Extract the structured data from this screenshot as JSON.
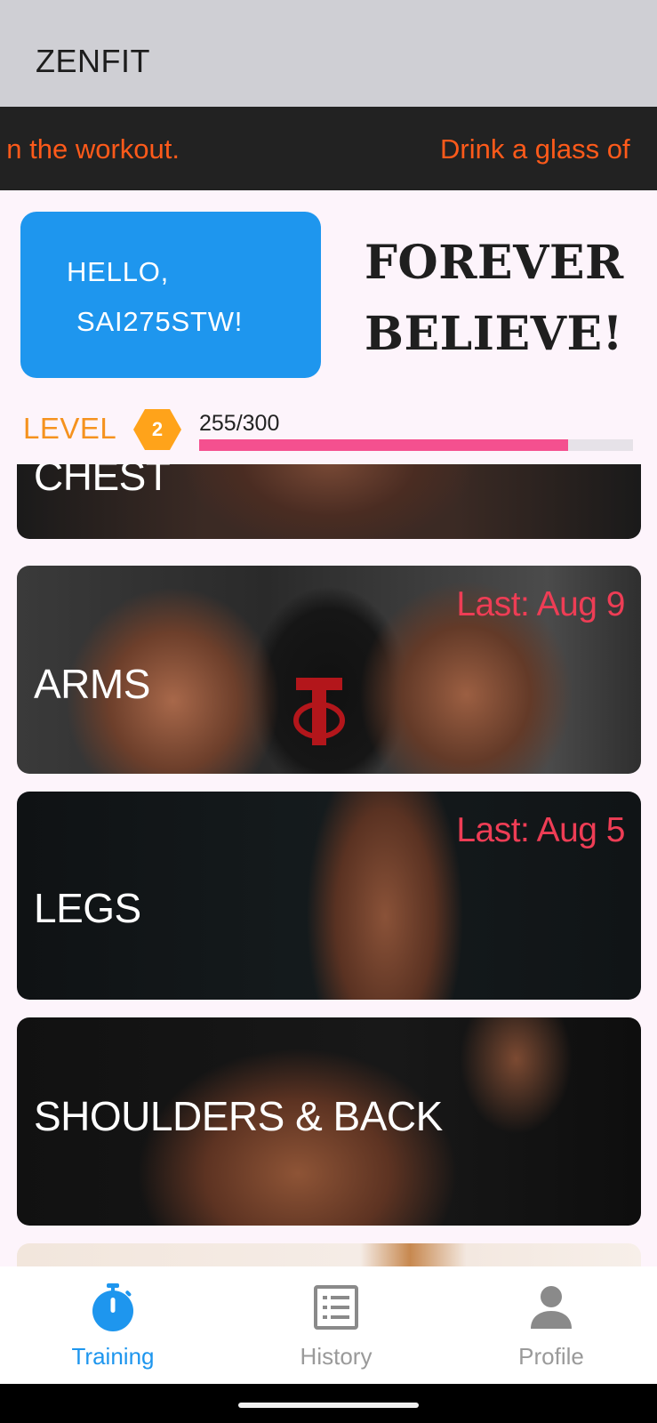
{
  "app_title": "ZENFIT",
  "ticker": {
    "tips": [
      "n the workout.",
      "Drink a glass of"
    ],
    "color": "#ff5a1a"
  },
  "greeting": {
    "line1": "HELLO,",
    "line2": "SAI275STW!",
    "card_color": "#1e96ee"
  },
  "motto": "FOREVER BELIEVE!",
  "level": {
    "label": "LEVEL",
    "number": "2",
    "xp_text": "255/300",
    "progress_fraction": 0.85,
    "badge_color": "#ffa31a",
    "bar_color": "#f4508f"
  },
  "workouts": [
    {
      "name": "CHEST",
      "last": "",
      "image_icon": "chest-photo"
    },
    {
      "name": "ARMS",
      "last": "Last: Aug 9",
      "image_icon": "arms-photo"
    },
    {
      "name": "LEGS",
      "last": "Last: Aug 5",
      "image_icon": "legs-photo"
    },
    {
      "name": "SHOULDERS & BACK",
      "last": "",
      "image_icon": "shoulders-back-photo"
    },
    {
      "name": "",
      "last": "",
      "image_icon": "next-workout-photo"
    }
  ],
  "nav": {
    "items": [
      {
        "label": "Training",
        "icon": "stopwatch-icon",
        "active": true
      },
      {
        "label": "History",
        "icon": "list-icon",
        "active": false
      },
      {
        "label": "Profile",
        "icon": "person-icon",
        "active": false
      }
    ],
    "active_color": "#1e96ee",
    "inactive_color": "#9a9a9a"
  }
}
